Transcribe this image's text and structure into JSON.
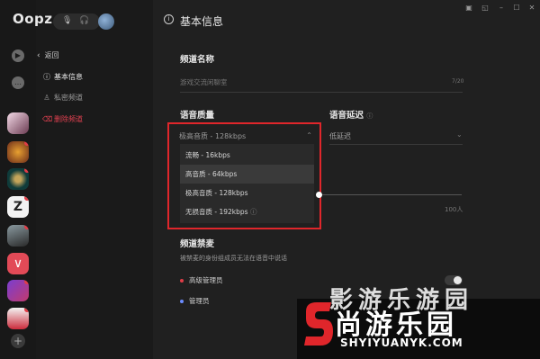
{
  "app": {
    "logo": "Oopz"
  },
  "rail": {
    "top_icons": [
      "play-icon",
      "chat-icon"
    ],
    "servers": [
      {
        "name": "server-anime-girl",
        "colors": [
          "#f3d9e6",
          "#6b3b52"
        ]
      },
      {
        "name": "server-hearthstone",
        "colors": [
          "#e7a030",
          "#6a2a1a"
        ]
      },
      {
        "name": "server-league",
        "colors": [
          "#0f3b3a",
          "#c4a55a"
        ]
      },
      {
        "name": "server-z",
        "colors": [
          "#f2f2f2",
          "#d8d8d8"
        ]
      },
      {
        "name": "server-warrior",
        "colors": [
          "#5e6a6e",
          "#2a2a2a"
        ]
      },
      {
        "name": "server-vee",
        "colors": [
          "#e24a57",
          "#c02a3a"
        ]
      },
      {
        "name": "server-game",
        "colors": [
          "#7a3ed1",
          "#c23a6e"
        ]
      },
      {
        "name": "server-anime-2",
        "colors": [
          "#f4f4f4",
          "#cc2b3b"
        ]
      }
    ],
    "add_label": "+"
  },
  "sidebar": {
    "back_label": "返回",
    "items": [
      {
        "label": "基本信息",
        "color": "#e8e8e8",
        "icon": "ⓘ"
      },
      {
        "label": "私密频道",
        "color": "#9a9a9a",
        "icon": "♙"
      },
      {
        "label": "删除频道",
        "color": "#e04050",
        "icon": "🗑"
      }
    ]
  },
  "header": {
    "title": "基本信息"
  },
  "form": {
    "channel_name": {
      "label": "频道名称",
      "placeholder": "游戏交流闲聊室",
      "counter": "7/20"
    },
    "voice_quality": {
      "label": "语音质量",
      "selected": "极高音质 - 128kbps",
      "options": [
        "流畅 - 16kbps",
        "高音质 - 64kbps",
        "极高音质 - 128kbps",
        "无损音质 - 192kbps"
      ],
      "highlighted_index": 1
    },
    "voice_delay": {
      "label": "语音延迟",
      "selected": "低延迟"
    },
    "member_limit": {
      "max_label": "100人"
    },
    "mute": {
      "label": "频道禁麦",
      "description": "被禁麦的身份组成员无法在语音中说话",
      "roles": [
        {
          "label": "高级管理员",
          "color": "#e03d47"
        },
        {
          "label": "管理员",
          "color": "#6b8cff"
        }
      ]
    }
  },
  "watermark": {
    "big": "尚游乐园",
    "small": "SHYIYUANYK.COM",
    "ghost": "影游乐游园"
  }
}
